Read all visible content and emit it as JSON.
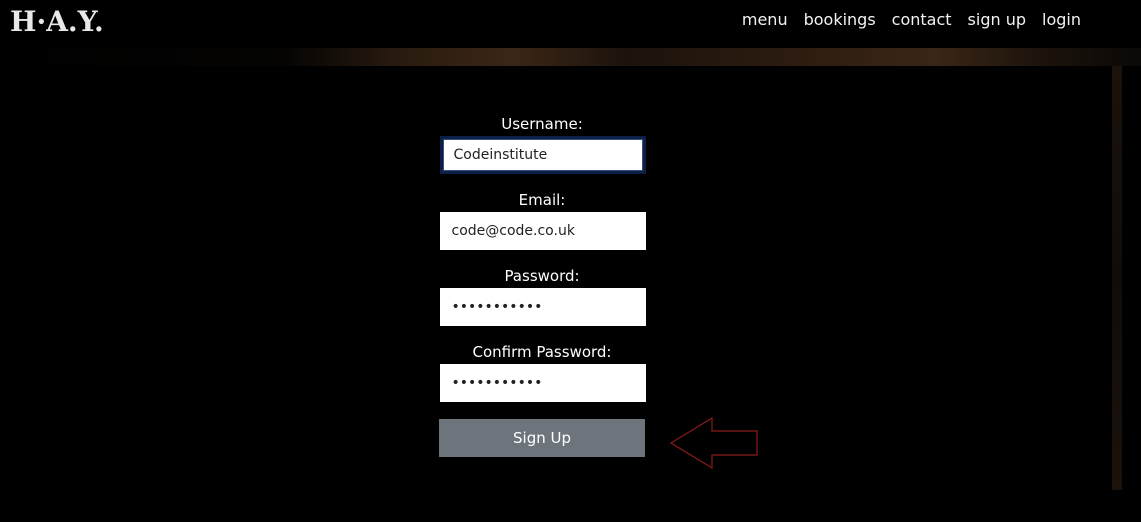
{
  "brand": {
    "logo_text": "H·A.Y."
  },
  "nav": {
    "items": [
      {
        "label": "menu"
      },
      {
        "label": "bookings"
      },
      {
        "label": "contact"
      },
      {
        "label": "sign up"
      },
      {
        "label": "login"
      }
    ]
  },
  "form": {
    "username": {
      "label": "Username:",
      "value": "Codeinstitute"
    },
    "email": {
      "label": "Email:",
      "value": "code@code.co.uk"
    },
    "password": {
      "label": "Password:",
      "value": "•••••••••••"
    },
    "confirm_password": {
      "label": "Confirm Password:",
      "value": "•••••••••••"
    },
    "submit_label": "Sign Up"
  },
  "colors": {
    "background": "#000000",
    "button": "#6d747c",
    "arrow_stroke": "#8b1a1a"
  },
  "annotation": {
    "icon": "left-arrow-icon"
  }
}
